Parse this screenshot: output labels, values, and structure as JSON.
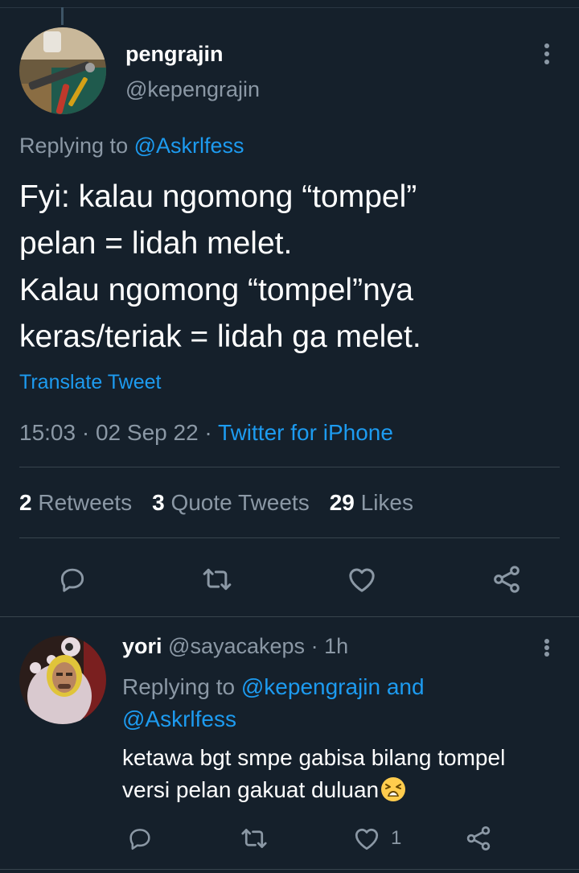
{
  "main_tweet": {
    "display_name": "pengrajin",
    "handle": "@kepengrajin",
    "replying_prefix": "Replying to ",
    "replying_to": "@Askrlfess",
    "text_lines": [
      "Fyi: kalau ngomong “tompel”",
      "pelan = lidah melet.",
      "Kalau ngomong “tompel”nya",
      "keras/teriak = lidah ga melet."
    ],
    "translate_label": "Translate Tweet",
    "time": "15:03",
    "date": "02 Sep 22",
    "separator": "·",
    "source": "Twitter for iPhone",
    "stats": {
      "retweets_count": "2",
      "retweets_label": "Retweets",
      "quotes_count": "3",
      "quotes_label": "Quote Tweets",
      "likes_count": "29",
      "likes_label": "Likes"
    },
    "avatar_icon": "toolbench-avatar"
  },
  "reply_tweet": {
    "display_name": "yori",
    "handle": "@sayacakeps",
    "separator": "·",
    "age": "1h",
    "replying_prefix": "Replying to ",
    "replying_to_1": "@kepengrajin",
    "replying_and": " and",
    "replying_to_2": "@Askrlfess",
    "text_lines": [
      "ketawa bgt smpe gabisa bilang tompel",
      "versi pelan gakuat duluan"
    ],
    "emoji": "tired-face-emoji",
    "likes_count": "1",
    "avatar_icon": "costume-avatar"
  },
  "colors": {
    "background": "#15202b",
    "accent": "#1d9bf0",
    "secondary_text": "#8b98a5",
    "divider": "#38444d"
  }
}
